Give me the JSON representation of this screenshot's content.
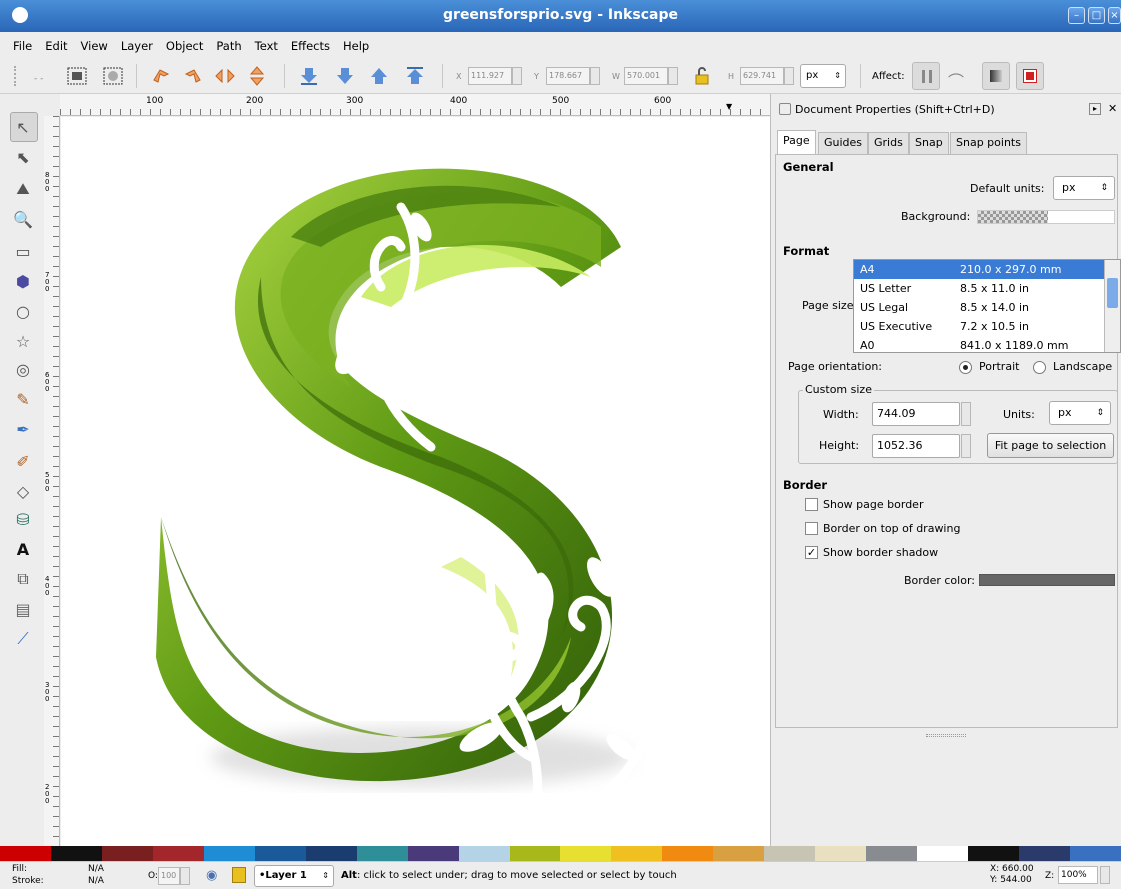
{
  "window": {
    "title": "greensforsprio.svg - Inkscape"
  },
  "menu": [
    "File",
    "Edit",
    "View",
    "Layer",
    "Object",
    "Path",
    "Text",
    "Effects",
    "Help"
  ],
  "toolbar": {
    "x_label": "X",
    "x_value": "111.927",
    "y_label": "Y",
    "y_value": "178.667",
    "w_label": "W",
    "w_value": "570.001",
    "h_label": "H",
    "h_value": "629.741",
    "units": "px",
    "affect_label": "Affect:"
  },
  "ruler": {
    "marks": [
      "100",
      "200",
      "300",
      "400",
      "500",
      "600"
    ]
  },
  "vruler": {
    "marks": [
      "800",
      "700",
      "600",
      "500",
      "400",
      "300",
      "200"
    ]
  },
  "panel": {
    "title": "Document Properties (Shift+Ctrl+D)",
    "tabs": [
      "Page",
      "Guides",
      "Grids",
      "Snap",
      "Snap points"
    ],
    "general": "General",
    "default_units_label": "Default units:",
    "default_units_value": "px",
    "background_label": "Background:",
    "format": "Format",
    "page_size_label": "Page size:",
    "page_sizes": [
      {
        "name": "A4",
        "size": "210.0 x 297.0 mm"
      },
      {
        "name": "US Letter",
        "size": "8.5 x 11.0 in"
      },
      {
        "name": "US Legal",
        "size": "8.5 x 14.0 in"
      },
      {
        "name": "US Executive",
        "size": "7.2 x 10.5 in"
      },
      {
        "name": "A0",
        "size": "841.0 x 1189.0 mm"
      }
    ],
    "orientation_label": "Page orientation:",
    "portrait": "Portrait",
    "landscape": "Landscape",
    "custom_size": "Custom size",
    "width_label": "Width:",
    "width_value": "744.09",
    "height_label": "Height:",
    "height_value": "1052.36",
    "units_label": "Units:",
    "units_value": "px",
    "fit_button": "Fit page to selection",
    "border": "Border",
    "show_border": "Show page border",
    "border_top": "Border on top of drawing",
    "border_shadow": "Show border shadow",
    "border_color_label": "Border color:"
  },
  "palette": [
    "#cc0000",
    "#111111",
    "#7a1f1f",
    "#a3262a",
    "#1f8dd6",
    "#1a5a9a",
    "#1b3c6e",
    "#2f8f98",
    "#4a3a7a",
    "#b5d3e6",
    "#a8b81a",
    "#e8e030",
    "#f0c020",
    "#f08a10",
    "#d8a040",
    "#c8c4b4",
    "#e8e0c0",
    "#888c90",
    "#ffffff",
    "#111111",
    "#2a3a6a",
    "#3a70c0"
  ],
  "status": {
    "fill_label": "Fill:",
    "fill_value": "N/A",
    "stroke_label": "Stroke:",
    "stroke_value": "N/A",
    "opacity_label": "O:",
    "opacity_value": "100",
    "layer": "•Layer 1",
    "message_bold": "Alt",
    "message": ": click to select under; drag to move selected or select by touch",
    "x_coord": "X: 660.00",
    "y_coord": "Y: 544.00",
    "zoom_label": "Z:",
    "zoom_value": "100%"
  }
}
